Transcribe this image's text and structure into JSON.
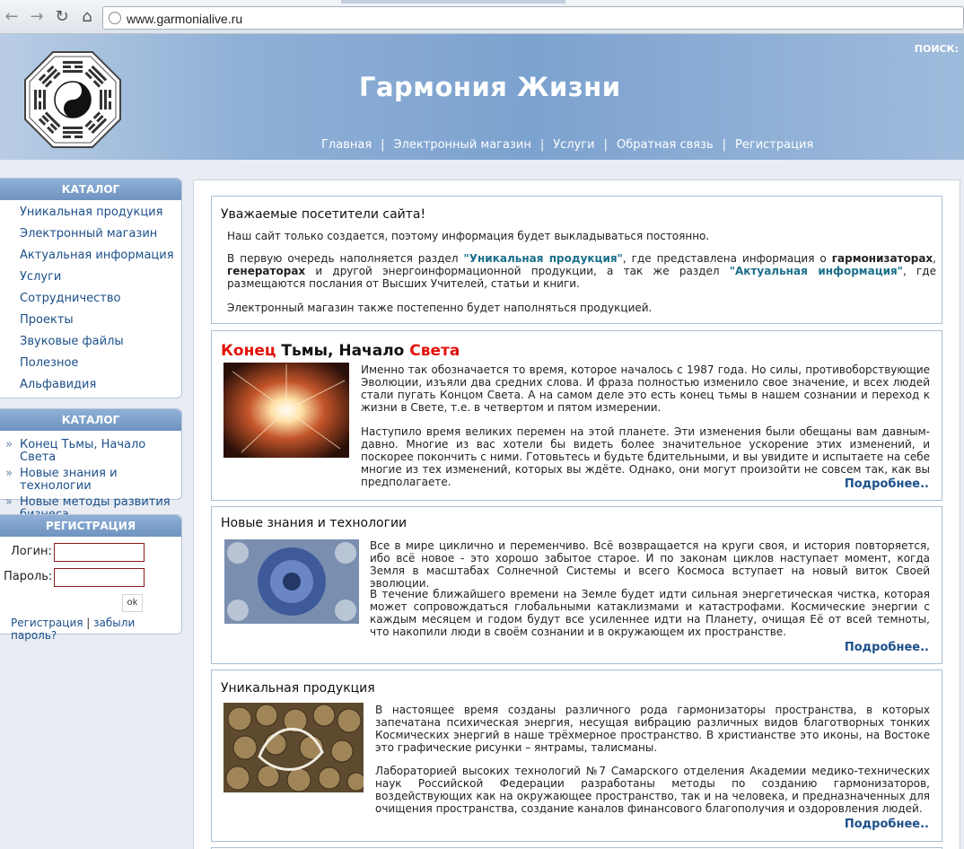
{
  "browser": {
    "url": "www.garmonialive.ru"
  },
  "header": {
    "site_title": "Гармония Жизни",
    "search_label": "ПОИСК:",
    "nav": [
      "Главная",
      "Электронный магазин",
      "Услуги",
      "Обратная связь",
      "Регистрация"
    ],
    "separator": "|"
  },
  "sidebar": {
    "catalog1": {
      "title": "КАТАЛОГ",
      "items": [
        "Уникальная продукция",
        "Электронный магазин",
        "Актуальная информация",
        "Услуги",
        "Сотрудничество",
        "Проекты",
        "Звуковые файлы",
        "Полезное",
        "Альфавидия"
      ]
    },
    "catalog2": {
      "title": "КАТАЛОГ",
      "bullet": "»",
      "items": [
        "Конец Тьмы, Начало Света",
        "Новые знания и технологии",
        "Новые методы развития бизнеса"
      ]
    },
    "registration": {
      "title": "РЕГИСТРАЦИЯ",
      "login_label": "Логин:",
      "password_label": "Пароль:",
      "ok_label": "ok",
      "register_link": "Регистрация",
      "separator": "|",
      "forgot_link": "забыли пароль?"
    }
  },
  "welcome": {
    "title": "Уважаемые посетители сайта!",
    "p1": "Наш сайт только создается, поэтому информация будет выкладываться постоянно.",
    "p2_a": "В первую очередь наполняется раздел ",
    "p2_link1": "\"Уникальная продукция\"",
    "p2_b": ", где представлена информация о ",
    "p2_bold1": "гармонизаторах",
    "p2_c": ", ",
    "p2_bold2": "генераторах",
    "p2_d": " и другой энергоинформационной продукции, а так же раздел ",
    "p2_link2": "\"Актуальная информация\"",
    "p2_e": ", где размещаются послания от Высших Учителей, статьи и книги.",
    "p3": "Электронный магазин также постепенно будет наполняться продукцией."
  },
  "articles": [
    {
      "title_parts": [
        "Конец",
        " Тьмы, Начало ",
        "Света"
      ],
      "p1": "Именно так обозначается то время, которое началось с 1987 года. Но силы, противоборствующие Эволюции, изъяли два средних слова. И фраза полностью изменило свое значение, и всех людей стали пугать Концом Света. А на самом деле это есть конец тьмы в нашем сознании и переход к жизни в Свете, т.е. в четвертом и пятом измерении.",
      "p2": "Наступило время великих перемен на этой планете. Эти изменения были обещаны вам давным-давно. Многие из вас хотели бы видеть более значительное ускорение этих изменений, и поскорее покончить с ними. Готовьтесь и будьте бдительными, и вы увидите и испытаете на себе многие из тех изменений, которых вы ждёте. Однако, они могут произойти не совсем так, как вы предполагаете.",
      "more": "Подробнее.."
    },
    {
      "title": "Новые знания и технологии",
      "p1": "Все в мире циклично и переменчиво. Всё возвращается на круги своя, и история повторяется, ибо всё новое - это хорошо забытое старое. И по законам циклов наступает момент, когда Земля в масштабах Солнечной Системы и всего Космоса вступает на новый виток Своей эволюции.",
      "p2": "В течение ближайшего времени на Земле будет идти сильная энергетическая чистка, которая может сопровождаться глобальными катаклизмами и катастрофами. Космические энергии с каждым месяцем и годом будут все усиленнее идти на Планету, очищая Её от всей темноты, что накопили люди в своём сознании и в окружающем их пространстве.",
      "more": "Подробнее.."
    },
    {
      "title": "Уникальная продукция",
      "p1": "В настоящее время созданы различного рода гармонизаторы пространства, в которых запечатана психическая энергия, несущая вибрацию различных видов благотворных тонких Космических энергий в наше трёхмерное пространство. В христианстве это иконы, на Востоке это графические рисунки – янтрамы, талисманы.",
      "p2": "Лабораторией высоких технологий №7 Самарского отделения Академии медико-технических наук Российской Федерации разработаны методы по созданию гармонизаторов, воздействующих как на окружающее пространство, так и на человека, и предназначенных для очищения пространства, создание каналов финансового благополучия и оздоровления людей.",
      "more": "Подробнее.."
    }
  ],
  "colors": {
    "header_blue": "#7ca2cf",
    "link_blue": "#1b4f8a",
    "title_red": "#e3120b"
  },
  "icons": [
    "back-arrow-icon",
    "forward-arrow-icon",
    "reload-icon",
    "home-icon",
    "site-info-icon",
    "bagua-yin-yang-logo"
  ]
}
